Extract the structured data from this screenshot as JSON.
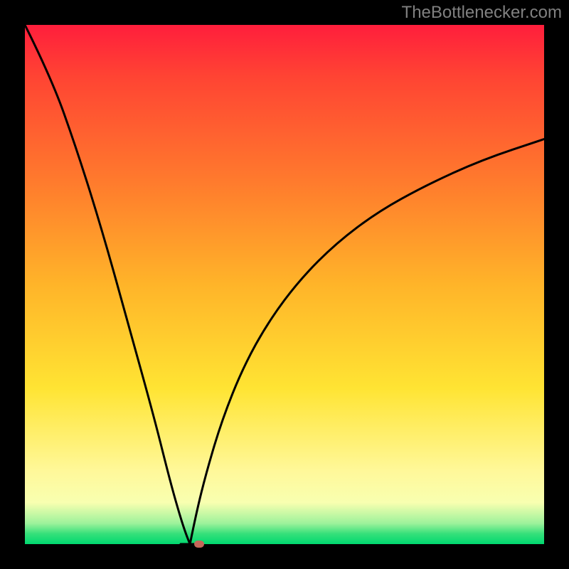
{
  "attribution": "TheBottlenecker.com",
  "colors": {
    "page_bg": "#000000",
    "gradient_top": "#ff1e3c",
    "gradient_mid": "#ffe433",
    "gradient_bottom": "#00d870",
    "curve": "#000000",
    "marker": "#c4675a"
  },
  "chart_data": {
    "type": "line",
    "title": "",
    "xlabel": "",
    "ylabel": "",
    "x_range": [
      0,
      100
    ],
    "y_range": [
      0,
      100
    ],
    "left_branch": {
      "x": [
        0,
        5,
        10,
        15,
        20,
        25,
        28,
        30,
        31,
        31.8
      ],
      "y": [
        100,
        90,
        76,
        60,
        42,
        24,
        12,
        5,
        2,
        0
      ]
    },
    "right_branch": {
      "x": [
        31.8,
        33,
        35,
        38,
        42,
        47,
        53,
        60,
        68,
        77,
        88,
        100
      ],
      "y": [
        0,
        6,
        14,
        24,
        34,
        43,
        51,
        58,
        64,
        69,
        74,
        78
      ]
    },
    "flat_segment": {
      "x": [
        30,
        33.5
      ],
      "y": [
        0,
        0
      ]
    },
    "marker": {
      "x": 33.5,
      "y": 0
    }
  }
}
